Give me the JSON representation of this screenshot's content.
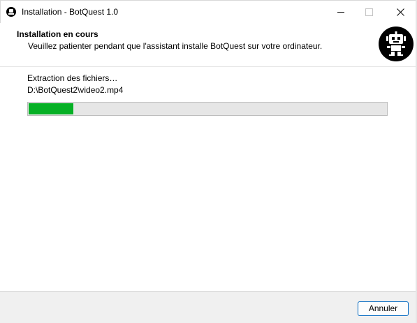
{
  "window": {
    "title": "Installation - BotQuest 1.0",
    "minimize_label": "–",
    "maximize_label": "☐",
    "close_label": "✕"
  },
  "header": {
    "title": "Installation en cours",
    "subtitle": "Veuillez patienter pendant que l'assistant installe BotQuest sur votre ordinateur.",
    "logo_icon": "robot-icon"
  },
  "main": {
    "status_text": "Extraction des fichiers…",
    "current_file": "D:\\BotQuest2\\video2.mp4",
    "progress_percent": 12.5,
    "progress_color": "#06b025"
  },
  "footer": {
    "cancel_label": "Annuler"
  }
}
